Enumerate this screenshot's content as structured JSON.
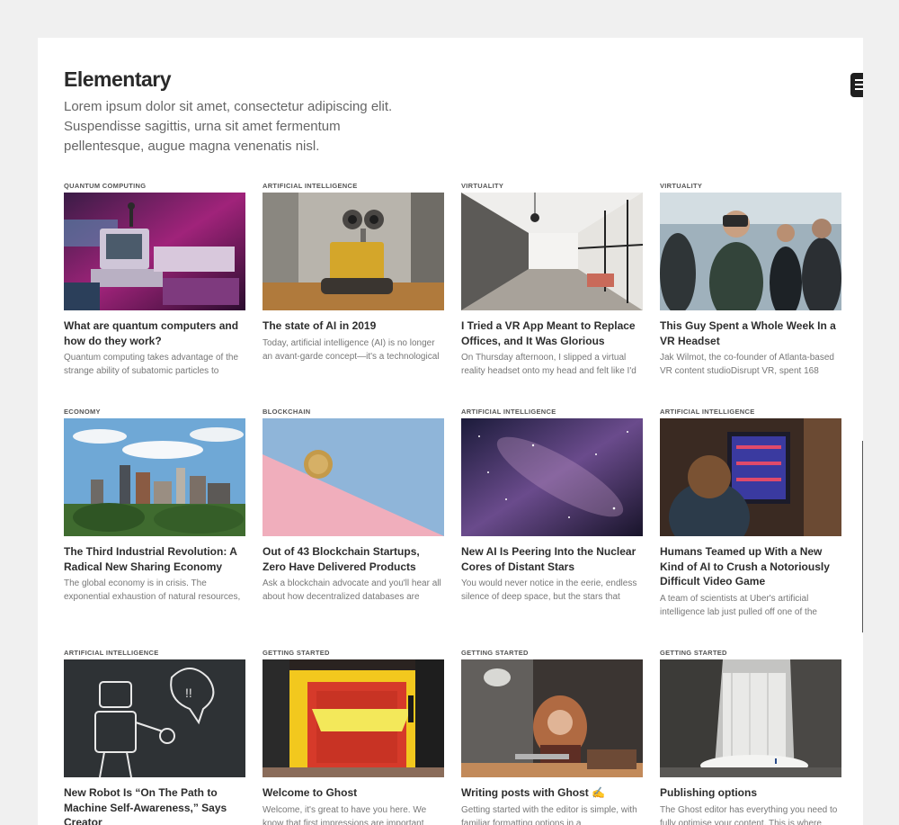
{
  "site": {
    "title": "Elementary",
    "description": "Lorem ipsum dolor sit amet, consectetur adipiscing elit. Suspendisse sagittis, urna sit amet fermentum pellentesque, augue magna venenatis nisl."
  },
  "menu_icon": "hamburger-icon",
  "posts": [
    {
      "tag": "Quantum Computing",
      "title": "What are quantum computers and how do they work?",
      "excerpt": "Quantum computing takes advantage of the strange ability of subatomic particles to",
      "image": "retro-computers"
    },
    {
      "tag": "Artificial Intelligence",
      "title": "The state of AI in 2019",
      "excerpt": "Today, artificial intelligence (AI) is no longer an avant-garde concept—it's a technological",
      "image": "wall-e-robot"
    },
    {
      "tag": "Virtuality",
      "title": "I Tried a VR App Meant to Replace Offices, and It Was Glorious",
      "excerpt": "On Thursday afternoon, I slipped a virtual reality headset onto my head and felt like I'd",
      "image": "office-hallway"
    },
    {
      "tag": "Virtuality",
      "title": "This Guy Spent a Whole Week In a VR Headset",
      "excerpt": "Jak Wilmot, the co-founder of Atlanta-based VR content studioDisrupt VR, spent 168",
      "image": "vr-crowd"
    },
    {
      "tag": "Economy",
      "title": "The Third Industrial Revolution: A Radical New Sharing Economy",
      "excerpt": "The global economy is in crisis. The exponential exhaustion of natural resources,",
      "image": "city-skyline"
    },
    {
      "tag": "Blockchain",
      "title": "Out of 43 Blockchain Startups, Zero Have Delivered Products",
      "excerpt": "Ask a blockchain advocate and you'll hear all about how decentralized databases are",
      "image": "coin-pastel"
    },
    {
      "tag": "Artificial Intelligence",
      "title": "New AI Is Peering Into the Nuclear Cores of Distant Stars",
      "excerpt": "You would never notice in the eerie, endless silence of deep space, but the stars that",
      "image": "galaxy"
    },
    {
      "tag": "Artificial Intelligence",
      "title": "Humans Teamed up With a New Kind of AI to Crush a Notoriously Difficult Video Game",
      "excerpt": "A team of scientists at Uber's artificial intelligence lab just pulled off one of the",
      "image": "arcade-kid"
    },
    {
      "tag": "Artificial Intelligence",
      "title": "New Robot Is “On The Path to Machine Self-Awareness,” Says Creator",
      "excerpt": "",
      "image": "robot-chalk"
    },
    {
      "tag": "Getting Started",
      "title": "Welcome to Ghost",
      "excerpt": "Welcome, it's great to have you here. We know that first impressions are important",
      "image": "hello-door"
    },
    {
      "tag": "Getting Started",
      "title": "Writing posts with Ghost ✍️",
      "excerpt": "Getting started with the editor is simple, with familiar formatting options in a",
      "image": "woman-laptop"
    },
    {
      "tag": "Getting Started",
      "title": "Publishing options",
      "excerpt": "The Ghost editor has everything you need to fully optimise your content. This is where",
      "image": "waterfall"
    }
  ]
}
